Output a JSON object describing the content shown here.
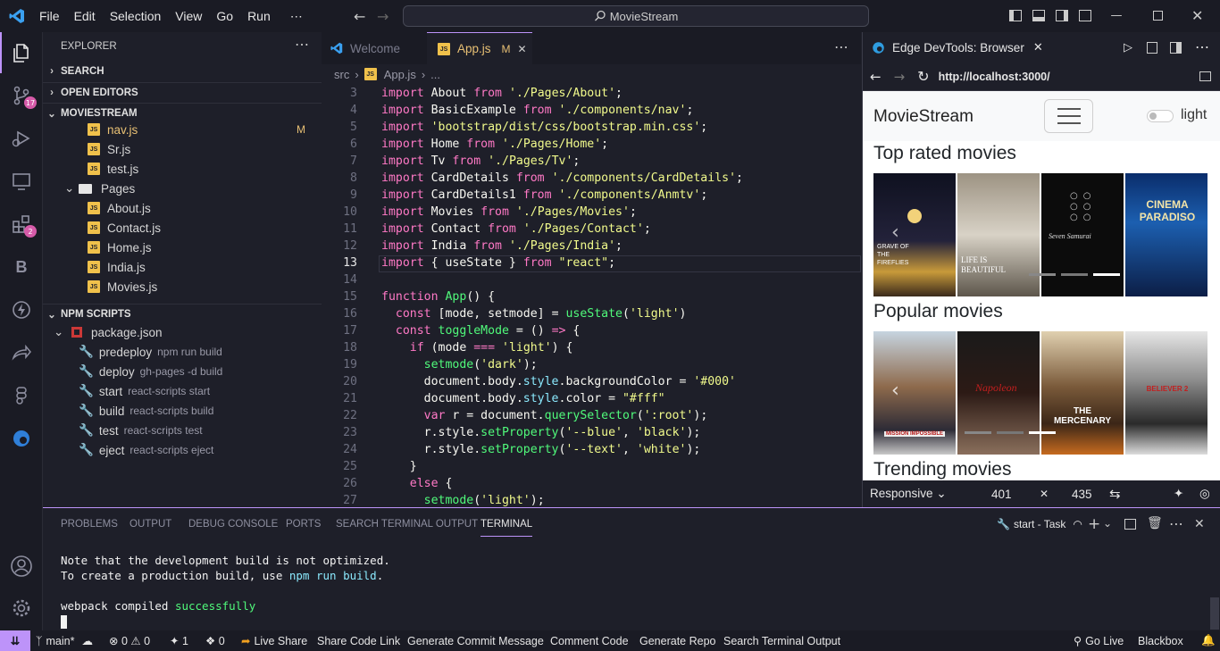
{
  "menu": [
    "File",
    "Edit",
    "Selection",
    "View",
    "Go",
    "Run",
    "⋯"
  ],
  "search": {
    "text": "MovieStream"
  },
  "activity": {
    "scm_badge": "17",
    "ext_badge": "2"
  },
  "sidebar": {
    "title": "EXPLORER",
    "sections": {
      "search": "SEARCH",
      "open_editors": "OPEN EDITORS",
      "project": "MOVIESTREAM",
      "npm": "NPM SCRIPTS"
    },
    "files": [
      {
        "name": "nav.js",
        "status": "M"
      },
      {
        "name": "Sr.js",
        "status": ""
      },
      {
        "name": "test.js",
        "status": ""
      }
    ],
    "folder": "Pages",
    "pages": [
      "About.js",
      "Contact.js",
      "Home.js",
      "India.js",
      "Movies.js"
    ],
    "package": "package.json",
    "scripts": [
      {
        "name": "predeploy",
        "cmd": "npm run build"
      },
      {
        "name": "deploy",
        "cmd": "gh-pages -d build"
      },
      {
        "name": "start",
        "cmd": "react-scripts start"
      },
      {
        "name": "build",
        "cmd": "react-scripts build"
      },
      {
        "name": "test",
        "cmd": "react-scripts test"
      },
      {
        "name": "eject",
        "cmd": "react-scripts eject"
      }
    ]
  },
  "editor": {
    "tabs": [
      {
        "label": "Welcome"
      },
      {
        "label": "App.js",
        "status": "M"
      }
    ],
    "breadcrumb": {
      "folder": "src",
      "file": "App.js",
      "more": "..."
    },
    "line_numbers": [
      "3",
      "4",
      "5",
      "6",
      "7",
      "8",
      "9",
      "10",
      "11",
      "12",
      "13",
      "14",
      "15",
      "16",
      "17",
      "18",
      "19",
      "20",
      "21",
      "22",
      "23",
      "24",
      "25",
      "26",
      "27"
    ]
  },
  "browser": {
    "tab_title": "Edge DevTools: Browser",
    "url": "http://localhost:3000/",
    "brand": "MovieStream",
    "toggle_label": "light",
    "sections": [
      "Top rated movies",
      "Popular movies",
      "Trending movies"
    ],
    "top_posters": [
      "Grave of the Fireflies",
      "Life is Beautiful",
      "Seven Samurai",
      "Cinema Paradiso"
    ],
    "top_poster_text": [
      "GRAVE OF THE FIREFLIES",
      "LIFE IS BEAUTIFUL",
      "Seven Samurai",
      "CINEMA PARADISO"
    ],
    "popular_posters": [
      "Mission: Impossible",
      "Napoleon",
      "The Mercenary",
      "Believer 2"
    ],
    "popular_poster_text": [
      "MISSION IMPOSSIBLE",
      "Napoleon",
      "THE MERCENARY",
      "BELIEVER 2"
    ],
    "device": "Responsive",
    "width": "401",
    "times": "✕",
    "height": "435"
  },
  "panel": {
    "tabs": [
      "PROBLEMS",
      "OUTPUT",
      "DEBUG CONSOLE",
      "PORTS",
      "SEARCH TERMINAL OUTPUT",
      "TERMINAL"
    ],
    "task": "start - Task",
    "lines": {
      "l1": "Note that the development build is not optimized.",
      "l2a": "To create a production build, use ",
      "l2b": "npm run build",
      "l2c": ".",
      "l3a": "webpack compiled ",
      "l3b": "successfully"
    }
  },
  "status": {
    "branch": "main*",
    "errors": "0",
    "warnings": "0",
    "ports": "1",
    "radio": "0",
    "items": [
      "Live Share",
      "Share Code Link",
      "Generate Commit Message",
      "Comment Code",
      "Generate Repo",
      "Search Terminal Output"
    ],
    "right": [
      "Go Live",
      "Blackbox"
    ]
  },
  "colors": {
    "accent": "#bd93f9",
    "keyword": "#ff79c6",
    "string": "#f1fa8c",
    "function": "#50fa7b",
    "property": "#8be9fd",
    "badge": "#d65ba9"
  }
}
